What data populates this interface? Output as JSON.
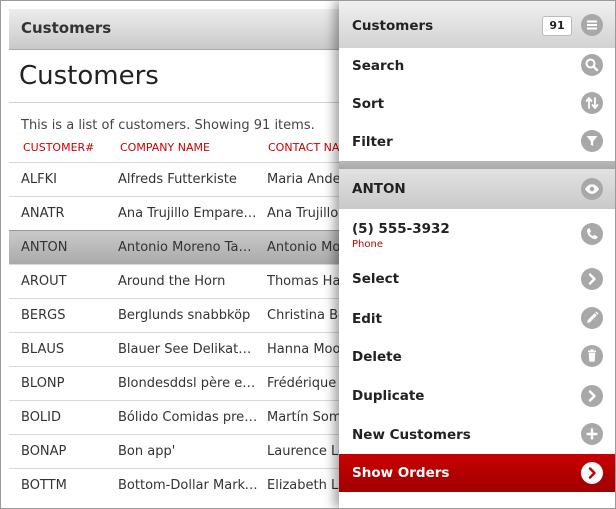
{
  "header": {
    "title": "Customers"
  },
  "page": {
    "title": "Customers",
    "description": "This is a list of customers. Showing 91 items."
  },
  "table": {
    "columns": [
      "CUSTOMER#",
      "COMPANY NAME",
      "CONTACT NAME"
    ],
    "rows": [
      {
        "id": "ALFKI",
        "company": "Alfreds Futterkiste",
        "contact": "Maria Anders"
      },
      {
        "id": "ANATR",
        "company": "Ana Trujillo Emparedados y helados",
        "contact": "Ana Trujillo"
      },
      {
        "id": "ANTON",
        "company": "Antonio Moreno Taquería",
        "contact": "Antonio Moreno"
      },
      {
        "id": "AROUT",
        "company": "Around the Horn",
        "contact": "Thomas Hardy"
      },
      {
        "id": "BERGS",
        "company": "Berglunds snabbköp",
        "contact": "Christina Berglund"
      },
      {
        "id": "BLAUS",
        "company": "Blauer See Delikatessen",
        "contact": "Hanna Moos"
      },
      {
        "id": "BLONP",
        "company": "Blondesddsl père et fils",
        "contact": "Frédérique Citeaux"
      },
      {
        "id": "BOLID",
        "company": "Bólido Comidas preparadas",
        "contact": "Martín Sommer"
      },
      {
        "id": "BONAP",
        "company": "Bon app'",
        "contact": "Laurence Lebihan"
      },
      {
        "id": "BOTTM",
        "company": "Bottom-Dollar Markets",
        "contact": "Elizabeth Lincoln"
      }
    ],
    "selected_id": "ANTON"
  },
  "menu": {
    "header": {
      "label": "Customers",
      "count": "91"
    },
    "search": "Search",
    "sort": "Sort",
    "filter": "Filter",
    "record": {
      "label": "ANTON"
    },
    "phone": {
      "value": "(5) 555-3932",
      "label": "Phone"
    },
    "select": "Select",
    "edit": "Edit",
    "delete": "Delete",
    "duplicate": "Duplicate",
    "new_customers": "New Customers",
    "show_orders": "Show Orders"
  },
  "colors": {
    "accent_red": "#c00000",
    "header_text": "#cc0000"
  },
  "icons": {
    "menu": "hamburger-icon",
    "search": "search-icon",
    "sort": "sort-icon",
    "filter": "filter-icon",
    "record": "eye-icon",
    "phone": "phone-icon",
    "select": "chevron-right-icon",
    "edit": "pencil-icon",
    "delete": "trash-icon",
    "duplicate": "chevron-right-icon",
    "new": "plus-icon",
    "show_orders": "chevron-right-icon"
  }
}
